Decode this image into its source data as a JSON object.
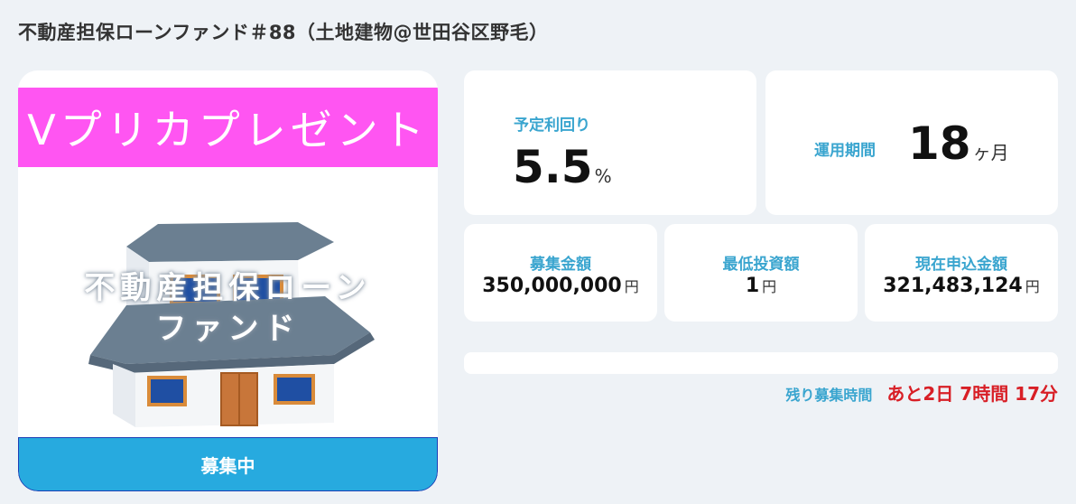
{
  "page": {
    "title": "不動産担保ローンファンド＃88（土地建物@世田谷区野毛）"
  },
  "image_card": {
    "banner_text": "Vプリカプレゼント",
    "overlay_line1": "不動産担保ローン",
    "overlay_line2": "ファンド",
    "status_label": "募集中",
    "colors": {
      "banner": "#ff55f2",
      "status": "#27aadf"
    }
  },
  "yield": {
    "label": "予定利回り",
    "value": "5.5",
    "unit": "%"
  },
  "period": {
    "label": "運用期間",
    "value": "18",
    "unit": "ヶ月"
  },
  "target_amount": {
    "label": "募集金額",
    "value": "350,000,000",
    "unit": "円"
  },
  "min_investment": {
    "label": "最低投資額",
    "value": "1",
    "unit": "円"
  },
  "applied_amount": {
    "label": "現在申込金額",
    "value": "321,483,124",
    "unit": "円"
  },
  "progress": {
    "fraction": 0
  },
  "remaining": {
    "label": "残り募集時間",
    "value": "あと2日 7時間 17分"
  }
}
